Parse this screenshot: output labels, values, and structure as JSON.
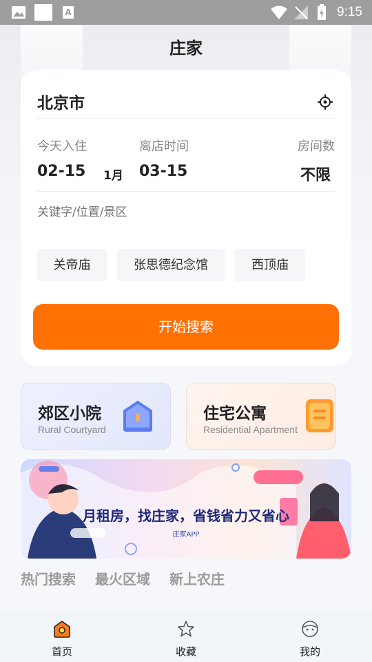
{
  "status_bar": {
    "time": "9:15"
  },
  "header": {
    "title": "庄家"
  },
  "search": {
    "city": "北京市",
    "checkin_label": "今天入住",
    "checkin_date": "02-15",
    "duration": "1月",
    "checkout_label": "离店时间",
    "checkout_date": "03-15",
    "rooms_label": "房间数",
    "rooms_value": "不限",
    "keyword_placeholder": "关键字/位置/景区",
    "chips": [
      "关帝庙",
      "张思德纪念馆",
      "西顶庙"
    ],
    "button_label": "开始搜索"
  },
  "categories": [
    {
      "title": "郊区小院",
      "subtitle": "Rural Courtyard"
    },
    {
      "title": "住宅公寓",
      "subtitle": "Residential Apartment"
    }
  ],
  "banner": {
    "text": "月租房，找庄家，省钱省力又省心",
    "sub": "庄家APP"
  },
  "tabs": [
    "热门搜索",
    "最火区域",
    "新上农庄"
  ],
  "bottom_nav": [
    {
      "label": "首页",
      "icon": "home-icon"
    },
    {
      "label": "收藏",
      "icon": "star-icon"
    },
    {
      "label": "我的",
      "icon": "profile-icon"
    }
  ],
  "colors": {
    "accent": "#ff7005",
    "courtyard_icon": "#5b7cf0",
    "apartment_icon": "#ff9b2e"
  }
}
